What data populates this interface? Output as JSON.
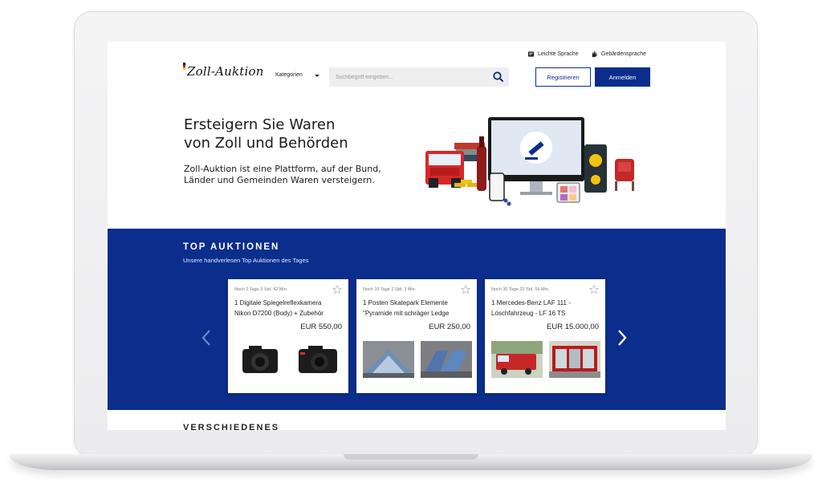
{
  "header": {
    "accessibility": {
      "easy_language": "Leichte Sprache",
      "sign_language": "Gebärdensprache"
    },
    "logo_text": "Zoll-Auktion",
    "categories_label": "Kategorien",
    "search": {
      "placeholder": "Suchbegriff eingeben...",
      "value": ""
    },
    "register_label": "Registrieren",
    "login_label": "Anmelden"
  },
  "hero": {
    "title_line1": "Ersteigern Sie Waren",
    "title_line2": "von Zoll und Behörden",
    "text_line1": "Zoll-Auktion ist eine Plattform, auf der Bund,",
    "text_line2": "Länder und Gemeinden Waren versteigern."
  },
  "top_auctions": {
    "title": "TOP AUKTIONEN",
    "subtitle": "Unsere handverlesen Top Auktionen des Tages",
    "cards": [
      {
        "time": "Noch 2 Tage 3 Std. 42 Min.",
        "title_line1": "1 Digitale Spiegelreflexkamera",
        "title_line2": "Nikon D7200 (Body) + Zubehör",
        "price": "EUR 550,00"
      },
      {
        "time": "Noch 10 Tage 2 Std. 3 Min.",
        "title_line1": "1 Posten Skatepark Elemente",
        "title_line2": "\"Pyramide mit schräger Ledge",
        "price": "EUR 250,00"
      },
      {
        "time": "Noch 30 Tage 22 Std. 59 Min.",
        "title_line1": "1 Mercedes-Benz LAF 111 -",
        "title_line2": "Löschfahrzeug - LF 16 TS",
        "price": "EUR 15.000,00"
      }
    ]
  },
  "next_section": {
    "title": "VERSCHIEDENES"
  },
  "colors": {
    "brand_blue": "#0b2d8c",
    "search_bg": "#eeeeef"
  },
  "icons": {
    "easy_language": "easy-language-icon",
    "sign_language": "sign-language-icon",
    "search": "search-icon",
    "star": "star-icon",
    "prev": "chevron-left-icon",
    "next": "chevron-right-icon"
  }
}
